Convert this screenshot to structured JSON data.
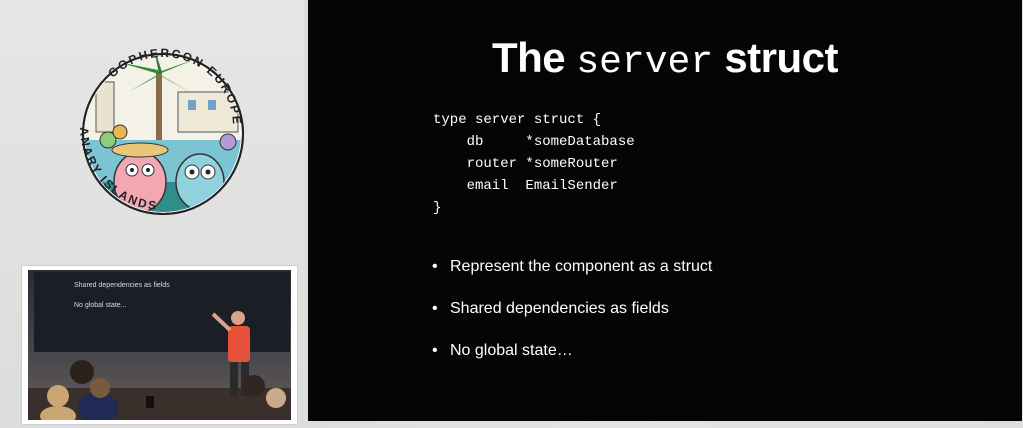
{
  "logo": {
    "arc_text_top": "GOPHERCON EUROPE",
    "arc_text_bottom": "CANARY ISLANDS"
  },
  "video_inset": {
    "bullets": [
      "Shared dependencies as fields",
      "No global state..."
    ]
  },
  "slide": {
    "title_prefix": "The",
    "title_code": "server",
    "title_suffix": "struct",
    "code": "type server struct {\n    db     *someDatabase\n    router *someRouter\n    email  EmailSender\n}",
    "bullets": [
      "Represent the component as a struct",
      "Shared dependencies as fields",
      "No global state…"
    ]
  },
  "colors": {
    "slide_bg": "#050505",
    "slide_text": "#ffffff",
    "sidebar_bg": "#e0e0e0",
    "shirt": "#e8523a"
  }
}
